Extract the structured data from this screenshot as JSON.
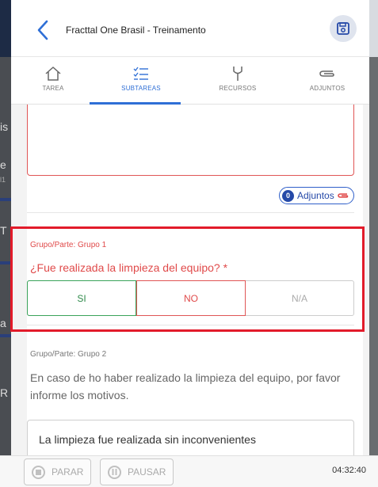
{
  "header": {
    "title": "Fracttal One Brasil - Treinamento"
  },
  "tabs": [
    {
      "label": "TAREA",
      "icon": "home-icon"
    },
    {
      "label": "SUBTAREAS",
      "icon": "checklist-icon"
    },
    {
      "label": "RECURSOS",
      "icon": "tools-icon"
    },
    {
      "label": "ADJUNTOS",
      "icon": "paperclip-icon"
    }
  ],
  "attachments": {
    "count": "0",
    "label": "Adjuntos"
  },
  "question1": {
    "group": "Grupo/Parte: Grupo 1",
    "text": "¿Fue realizada la limpieza del equipo? *",
    "options": [
      "SI",
      "NO",
      "N/A"
    ]
  },
  "question2": {
    "group": "Grupo/Parte: Grupo 2",
    "text": "En caso de ho haber realizado la limpieza del equipo, por favor informe los motivos.",
    "answer": "La limpieza fue realizada sin inconvenientes"
  },
  "footer": {
    "stop_label": "PARAR",
    "pause_label": "PAUSAR",
    "timer": "04:32:40"
  },
  "background_fragments": [
    "is",
    "e",
    "l1",
    "T",
    "a",
    "a",
    "R"
  ],
  "colors": {
    "accent": "#2f6fd6",
    "error": "#e04a4a",
    "success": "#3aa35a",
    "highlight": "#e21b2a"
  }
}
